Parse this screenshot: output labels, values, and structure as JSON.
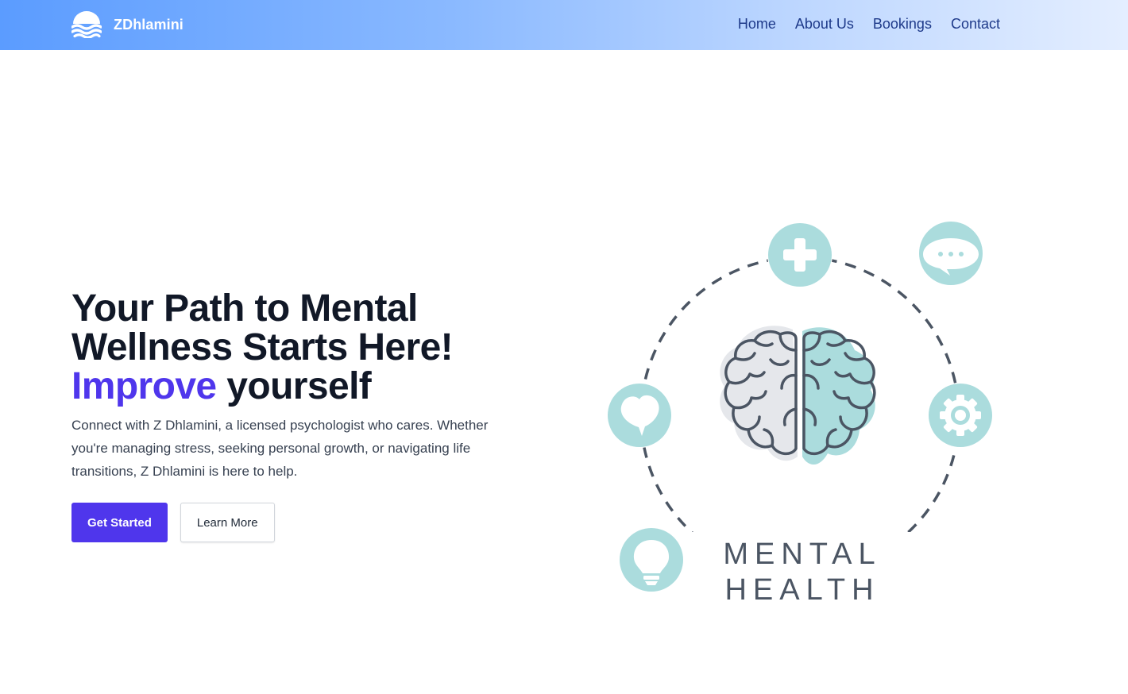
{
  "brand": {
    "name": "ZDhlamini",
    "logo_icon": "waves-logo-icon"
  },
  "nav": {
    "items": [
      {
        "label": "Home"
      },
      {
        "label": "About Us"
      },
      {
        "label": "Bookings"
      },
      {
        "label": "Contact"
      }
    ]
  },
  "hero": {
    "headline_line1": "Your Path to Mental",
    "headline_line2": "Wellness Starts Here!",
    "headline_accent": "Improve",
    "headline_rest": " yourself",
    "description": "Connect with Z Dhlamini, a licensed psychologist who cares. Whether you're managing stress, seeking personal growth, or navigating life transitions, Z Dhlamini is here to help.",
    "primary_button": "Get Started",
    "secondary_button": "Learn More"
  },
  "illustration": {
    "caption_line1": "MENTAL",
    "caption_line2": "HEALTH",
    "icons": [
      "plus-icon",
      "chat-bubble-icon",
      "heart-icon",
      "gear-icon",
      "lightbulb-icon",
      "brain-icon"
    ]
  },
  "colors": {
    "accent": "#4f36ec",
    "nav_link": "#1e3a8a",
    "teal": "#abdcdd",
    "illustration_stroke": "#4b5563"
  }
}
